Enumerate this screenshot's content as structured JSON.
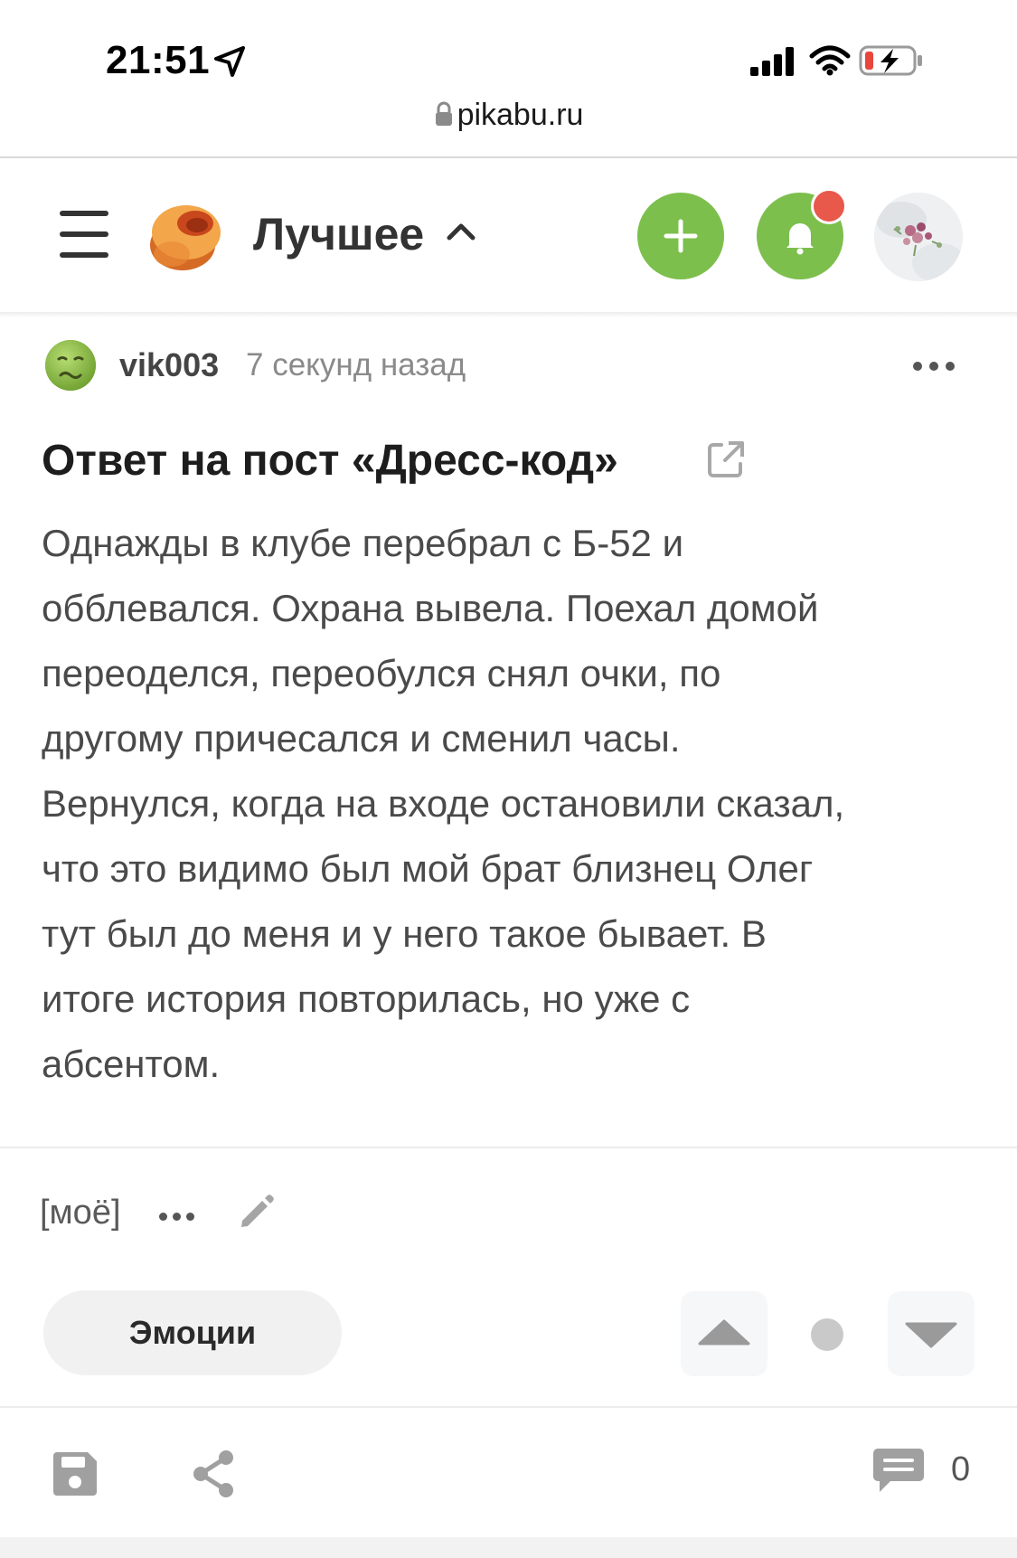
{
  "status_bar": {
    "time": "21:51",
    "battery_color": "#e8463b"
  },
  "browser": {
    "url": "pikabu.ru"
  },
  "header": {
    "section_title": "Лучшее",
    "accent_color": "#7cbf4d",
    "notification_dot_color": "#e8584b"
  },
  "post": {
    "author": "vik003",
    "time_ago": "7 секунд назад",
    "title": "Ответ на пост «Дресс-код»",
    "body_lines": [
      "Однажды в клубе перебрал с Б-52 и",
      "обблевался. Охрана вывела. Поехал домой",
      "переоделся, переобулся снял очки, по",
      "другому причесался и сменил часы.",
      "Вернулся, когда на входе остановили сказал,",
      "что это видимо был мой брат близнец Олег",
      "тут был до меня и у него такое бывает. В",
      "итоге история повторилась, но уже с",
      "абсентом."
    ],
    "tag": "[моё]",
    "emotions_label": "Эмоции",
    "comment_count": "0"
  }
}
